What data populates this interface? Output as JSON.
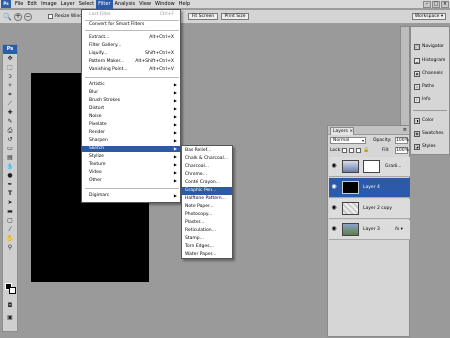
{
  "menubar": {
    "items": [
      "File",
      "Edit",
      "Image",
      "Layer",
      "Select",
      "Filter",
      "Analysis",
      "View",
      "Window",
      "Help"
    ],
    "active": "Filter",
    "app_icon": "photoshop-logo"
  },
  "options": {
    "resize_label": "Resize Wind",
    "fit_screen": "Fit Screen",
    "print_size": "Print Size",
    "workspace": "Workspace ▾"
  },
  "filter_menu": {
    "last_filter": "Last Filter",
    "last_filter_shortcut": "Ctrl+F",
    "convert": "Convert for Smart Filters",
    "extract": "Extract...",
    "extract_shortcut": "Alt+Ctrl+X",
    "gallery": "Filter Gallery...",
    "liquify": "Liquify...",
    "liquify_shortcut": "Shift+Ctrl+X",
    "pattern": "Pattern Maker...",
    "pattern_shortcut": "Alt+Shift+Ctrl+X",
    "vanishing": "Vanishing Point...",
    "vanishing_shortcut": "Alt+Ctrl+V",
    "groups": [
      "Artistic",
      "Blur",
      "Brush Strokes",
      "Distort",
      "Noise",
      "Pixelate",
      "Render",
      "Sharpen",
      "Sketch",
      "Stylize",
      "Texture",
      "Video",
      "Other"
    ],
    "digimarc": "Digimarc"
  },
  "sketch_menu": {
    "items": [
      "Bas Relief...",
      "Chalk & Charcoal...",
      "Charcoal...",
      "Chrome...",
      "Conté Crayon...",
      "Graphic Pen...",
      "Halftone Pattern...",
      "Note Paper...",
      "Photocopy...",
      "Plaster...",
      "Reticulation...",
      "Stamp...",
      "Torn Edges...",
      "Water Paper..."
    ],
    "highlighted": "Graphic Pen..."
  },
  "dock": {
    "items": [
      "Navigator",
      "Histogram",
      "Channels",
      "Paths",
      "Info",
      "Color",
      "Swatches",
      "Styles"
    ]
  },
  "layers_panel": {
    "tab": "Layers ×",
    "blend_mode": "Normal",
    "opacity_label": "Opacity:",
    "opacity_value": "100%",
    "lock_label": "Lock:",
    "fill_label": "Fill:",
    "fill_value": "100%",
    "layers": [
      {
        "name": "Gradi..."
      },
      {
        "name": "Layer 4"
      },
      {
        "name": "Layer 2 copy"
      },
      {
        "name": "Layer 3",
        "fx": "fx ▾"
      }
    ]
  },
  "colors": {
    "accent": "#2c5aa8",
    "canvas": "#000000",
    "workspace": "#9a9a9a"
  }
}
